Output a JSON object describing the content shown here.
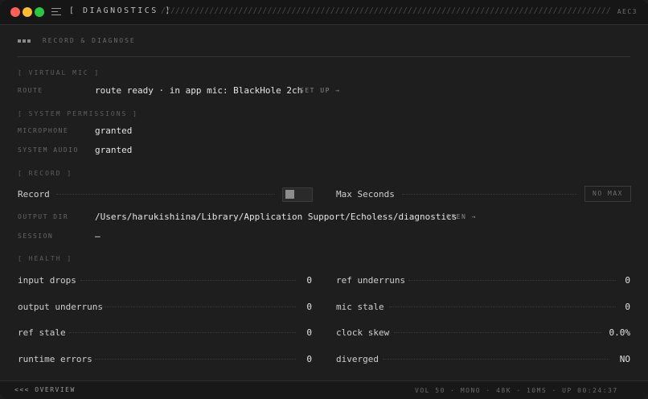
{
  "window": {
    "title": "[ DIAGNOSTICS ]",
    "hatch": "////////////////////////////////////////////////////////////////////////////////////////////////////////////////.",
    "tag": "AEC3",
    "traffic_lights": {
      "close": "#ff5f57",
      "minimize": "#febc2e",
      "zoom": "#28c840"
    }
  },
  "header": {
    "title": "RECORD & DIAGNOSE"
  },
  "virtual_mic": {
    "group_label": "[ VIRTUAL MIC ]",
    "route_label": "ROUTE",
    "route_value": "route ready · in app mic: BlackHole 2ch",
    "setup_action": "SET UP →"
  },
  "permissions": {
    "group_label": "[ SYSTEM PERMISSIONS ]",
    "microphone_label": "MICROPHONE",
    "microphone_value": "granted",
    "system_audio_label": "SYSTEM AUDIO",
    "system_audio_value": "granted"
  },
  "record": {
    "group_label": "[ RECORD ]",
    "record_label": "Record",
    "record_on": false,
    "max_seconds_label": "Max Seconds",
    "max_seconds_value": "NO MAX",
    "output_dir_label": "OUTPUT DIR",
    "output_dir_value": "/Users/harukishiina/Library/Application Support/Echoless/diagnostics",
    "open_action": "OPEN →",
    "session_label": "SESSION",
    "session_value": "—"
  },
  "health": {
    "group_label": "[ HEALTH ]",
    "metrics": [
      {
        "label": "input drops",
        "value": "0"
      },
      {
        "label": "ref underruns",
        "value": "0"
      },
      {
        "label": "output underruns",
        "value": "0"
      },
      {
        "label": "mic stale",
        "value": "0"
      },
      {
        "label": "ref stale",
        "value": "0"
      },
      {
        "label": "clock skew",
        "value": "0.0%"
      },
      {
        "label": "runtime errors",
        "value": "0"
      },
      {
        "label": "diverged",
        "value": "NO"
      }
    ]
  },
  "footer": {
    "back_label": "<<< OVERVIEW",
    "status": "VOL 50 · MONO · 48K · 10MS · UP 00:24:37"
  }
}
